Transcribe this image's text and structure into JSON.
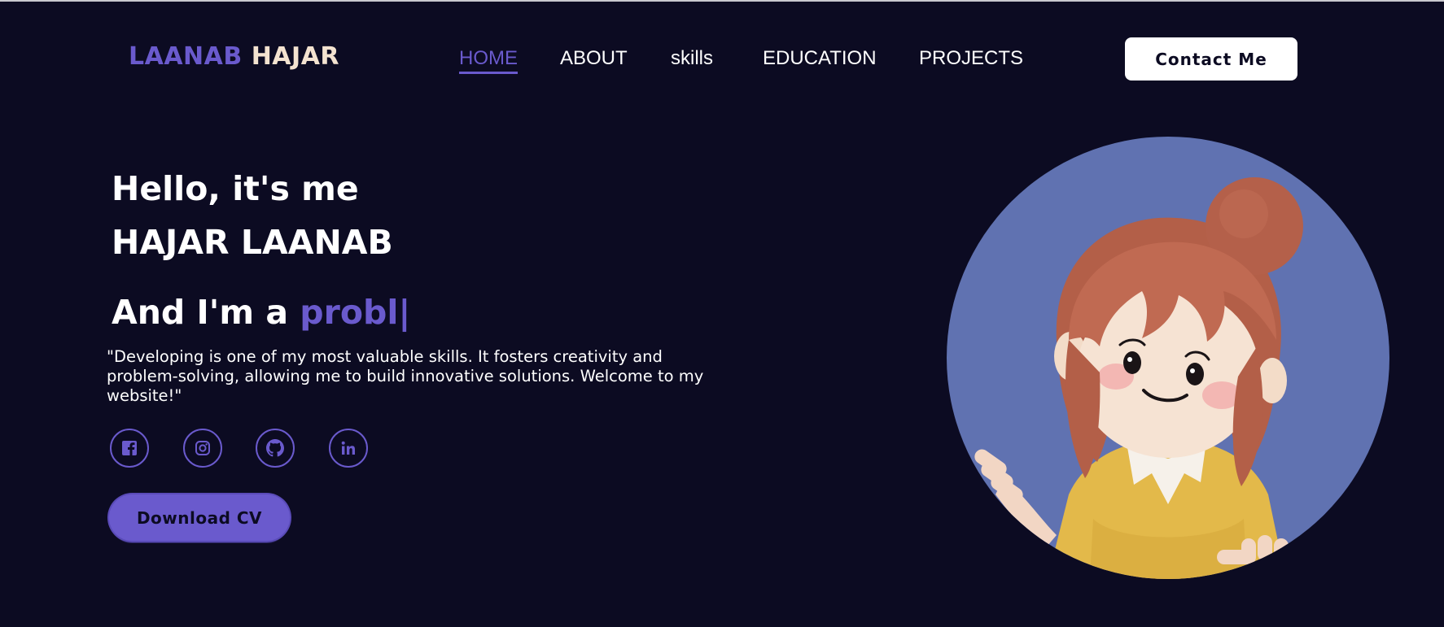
{
  "logo": {
    "first": "LAANAB",
    "last": "HAJAR"
  },
  "nav": {
    "items": [
      {
        "label": "HOME",
        "active": true
      },
      {
        "label": "ABOUT",
        "active": false
      },
      {
        "label": "skills",
        "active": false
      },
      {
        "label": "EDUCATION",
        "active": false
      },
      {
        "label": "PROJECTS",
        "active": false
      }
    ]
  },
  "header": {
    "contact_label": "Contact Me"
  },
  "hero": {
    "greeting": "Hello, it's me",
    "name": "HAJAR LAANAB",
    "role_prefix": "And I'm a",
    "role_typed": "probl|",
    "quote": "\"Developing is one of my most valuable skills. It fosters creativity and problem-solving, allowing me to build innovative solutions. Welcome to my website!\"",
    "download_label": "Download CV"
  },
  "social": {
    "icons": [
      "facebook-icon",
      "instagram-icon",
      "github-icon",
      "linkedin-icon"
    ]
  },
  "colors": {
    "background": "#0c0b22",
    "accent": "#6a5acd",
    "logo_last": "#f4e3d0",
    "avatar_circle": "#6072b1"
  }
}
